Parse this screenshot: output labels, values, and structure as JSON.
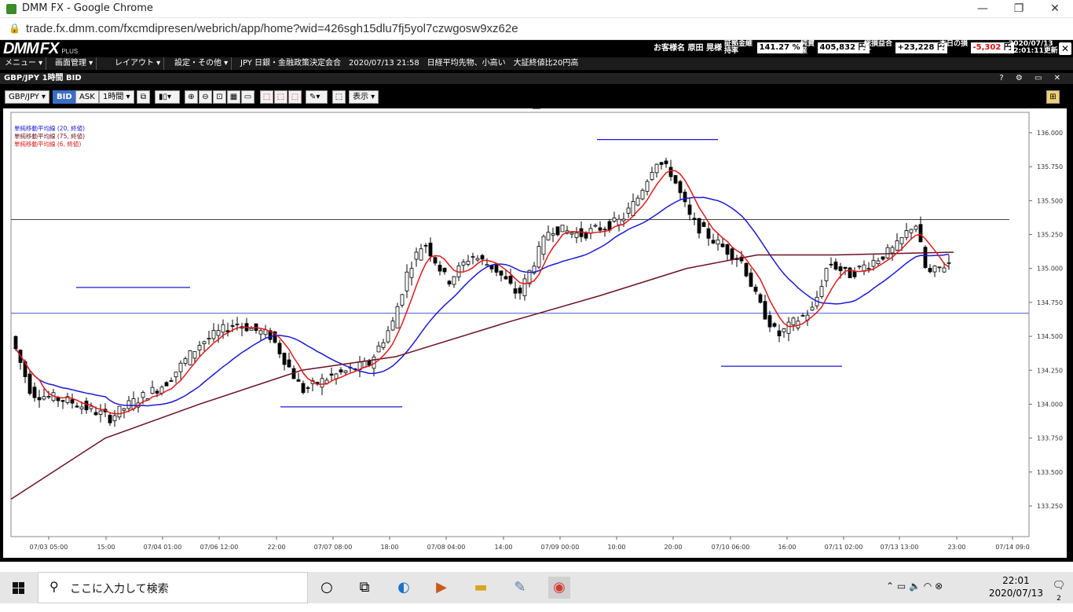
{
  "window": {
    "title": "DMM FX - Google Chrome",
    "minimize": "—",
    "maximize": "❐",
    "close": "✕"
  },
  "browser": {
    "url": "trade.fx.dmm.com/fxcmdipresen/webrich/app/home?wid=426sgh15dlu7fj5yol7czwgosw9xz62e"
  },
  "dmm": {
    "logo_main": "DMM",
    "logo_fx": "FX",
    "logo_plus": "PLUS",
    "customer_label": "お客様名",
    "customer_name": "原田 晃様",
    "margin_ratio_label": "証拠金維持率",
    "margin_ratio_l1": "証拠金維",
    "margin_ratio_l2": "持率",
    "margin_ratio_value": "141.27 %",
    "net_assets_l1": "純資",
    "net_assets_l2": "産",
    "net_assets_value": "405,832 円",
    "total_pl_l1": "総損益合",
    "total_pl_l2": "計",
    "total_pl_value": "+23,228 円",
    "today_pl_l1": "本日の損",
    "today_pl_l2": "益",
    "today_pl_value": "-5,302",
    "today_pl_unit": "円",
    "datetime_l1": "2020/07/13",
    "datetime_l2": "22:01:11更新",
    "close": "✕"
  },
  "menu": {
    "items": [
      "メニュー ▾",
      "画面管理 ▾",
      "レイアウト ▾",
      "設定・その他 ▾"
    ],
    "news": "JPY 日銀・金融政策決定会合　2020/07/13 21:58　日経平均先物、小高い　大証終値比20円高"
  },
  "chart_window": {
    "title": "GBP/JPY 1時間 BID",
    "controls": "? ⚙ ▭ ✕"
  },
  "toolbar": {
    "pair": "GBP/JPY ▾",
    "bid": "BID",
    "ask": "ASK",
    "timeframe": "1時間 ▾",
    "display": "表示 ▾"
  },
  "legend": [
    {
      "label": "単純移動平均線 (20, 終値)",
      "color": "#1a1ad6"
    },
    {
      "label": "単純移動平均線 (75, 終値)",
      "color": "#6b1020"
    },
    {
      "label": "単純移動平均線 (6, 終値)",
      "color": "#e01818"
    }
  ],
  "chart_data": {
    "type": "candlestick",
    "symbol": "GBP/JPY",
    "timeframe": "1時間",
    "price_type": "BID",
    "ylim": [
      133.0,
      136.1
    ],
    "y_ticks": [
      "136.000",
      "135.750",
      "135.500",
      "135.250",
      "135.000",
      "134.750",
      "134.500",
      "134.250",
      "134.000",
      "133.750",
      "133.500",
      "133.250"
    ],
    "x_ticks": [
      "07/03 05:00",
      "15:00",
      "07/04 01:00",
      "07/06 12:00",
      "22:00",
      "07/07 08:00",
      "18:00",
      "07/08 04:00",
      "14:00",
      "07/09 00:00",
      "10:00",
      "20:00",
      "07/10 06:00",
      "16:00",
      "07/11 02:00",
      "07/13 13:00",
      "23:00",
      "07/14 09:0"
    ],
    "horizontal_lines": [
      135.36,
      134.67
    ],
    "colors": {
      "up": "#ffffff",
      "down": "#000000",
      "sma20": "#1a1ad6",
      "sma75": "#6b1020",
      "sma6": "#e01818",
      "lines": "#1a1ad6"
    }
  },
  "taskbar": {
    "search_placeholder": "ここに入力して検索",
    "time": "22:01",
    "date": "2020/07/13",
    "notifications": "2"
  }
}
